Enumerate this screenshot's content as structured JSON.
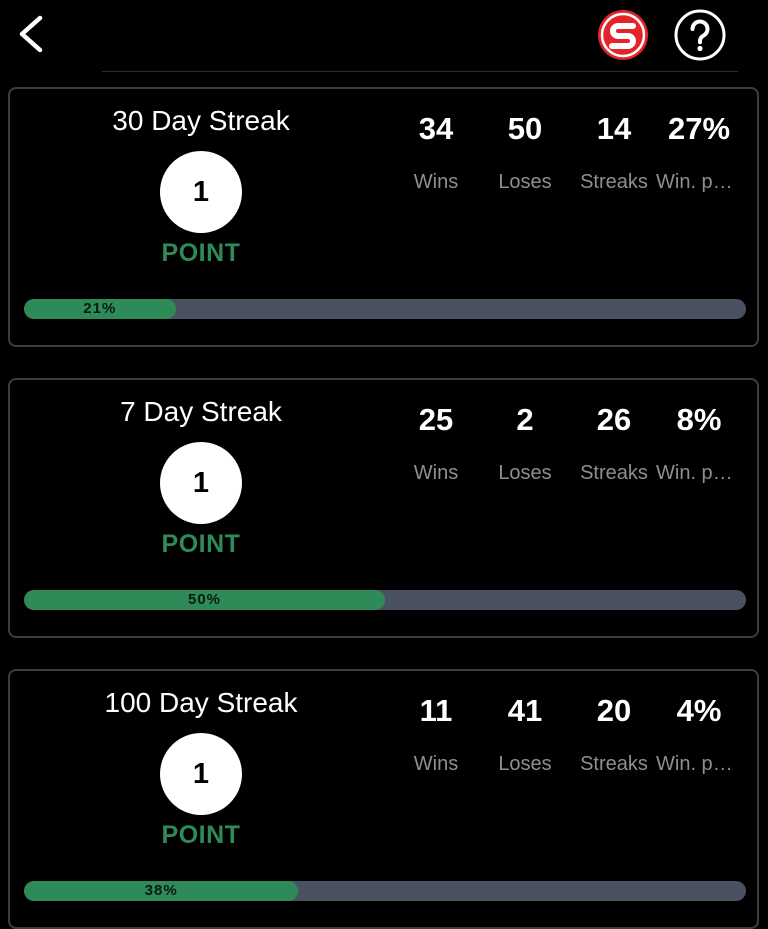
{
  "header": {
    "back_icon": "chevron-left-icon",
    "logo_icon": "brand-s-logo-icon",
    "help_icon": "question-mark-icon",
    "colors": {
      "logo_red": "#e3242b",
      "accent_green": "#2e8b57",
      "progress_track": "#4a5261"
    }
  },
  "streaks": [
    {
      "title": "30 Day Streak",
      "points": "1",
      "point_label": "POINT",
      "stats": [
        {
          "value": "34",
          "label": "Wins"
        },
        {
          "value": "50",
          "label": "Loses"
        },
        {
          "value": "14",
          "label": "Streaks"
        },
        {
          "value": "27%",
          "label": "Win. percentage"
        }
      ],
      "progress": 21,
      "progress_label": "21%"
    },
    {
      "title": "7 Day Streak",
      "points": "1",
      "point_label": "POINT",
      "stats": [
        {
          "value": "25",
          "label": "Wins"
        },
        {
          "value": "2",
          "label": "Loses"
        },
        {
          "value": "26",
          "label": "Streaks"
        },
        {
          "value": "8%",
          "label": "Win. percentage"
        }
      ],
      "progress": 50,
      "progress_label": "50%"
    },
    {
      "title": "100 Day Streak",
      "points": "1",
      "point_label": "POINT",
      "stats": [
        {
          "value": "11",
          "label": "Wins"
        },
        {
          "value": "41",
          "label": "Loses"
        },
        {
          "value": "20",
          "label": "Streaks"
        },
        {
          "value": "4%",
          "label": "Win. percentage"
        }
      ],
      "progress": 38,
      "progress_label": "38%"
    }
  ]
}
